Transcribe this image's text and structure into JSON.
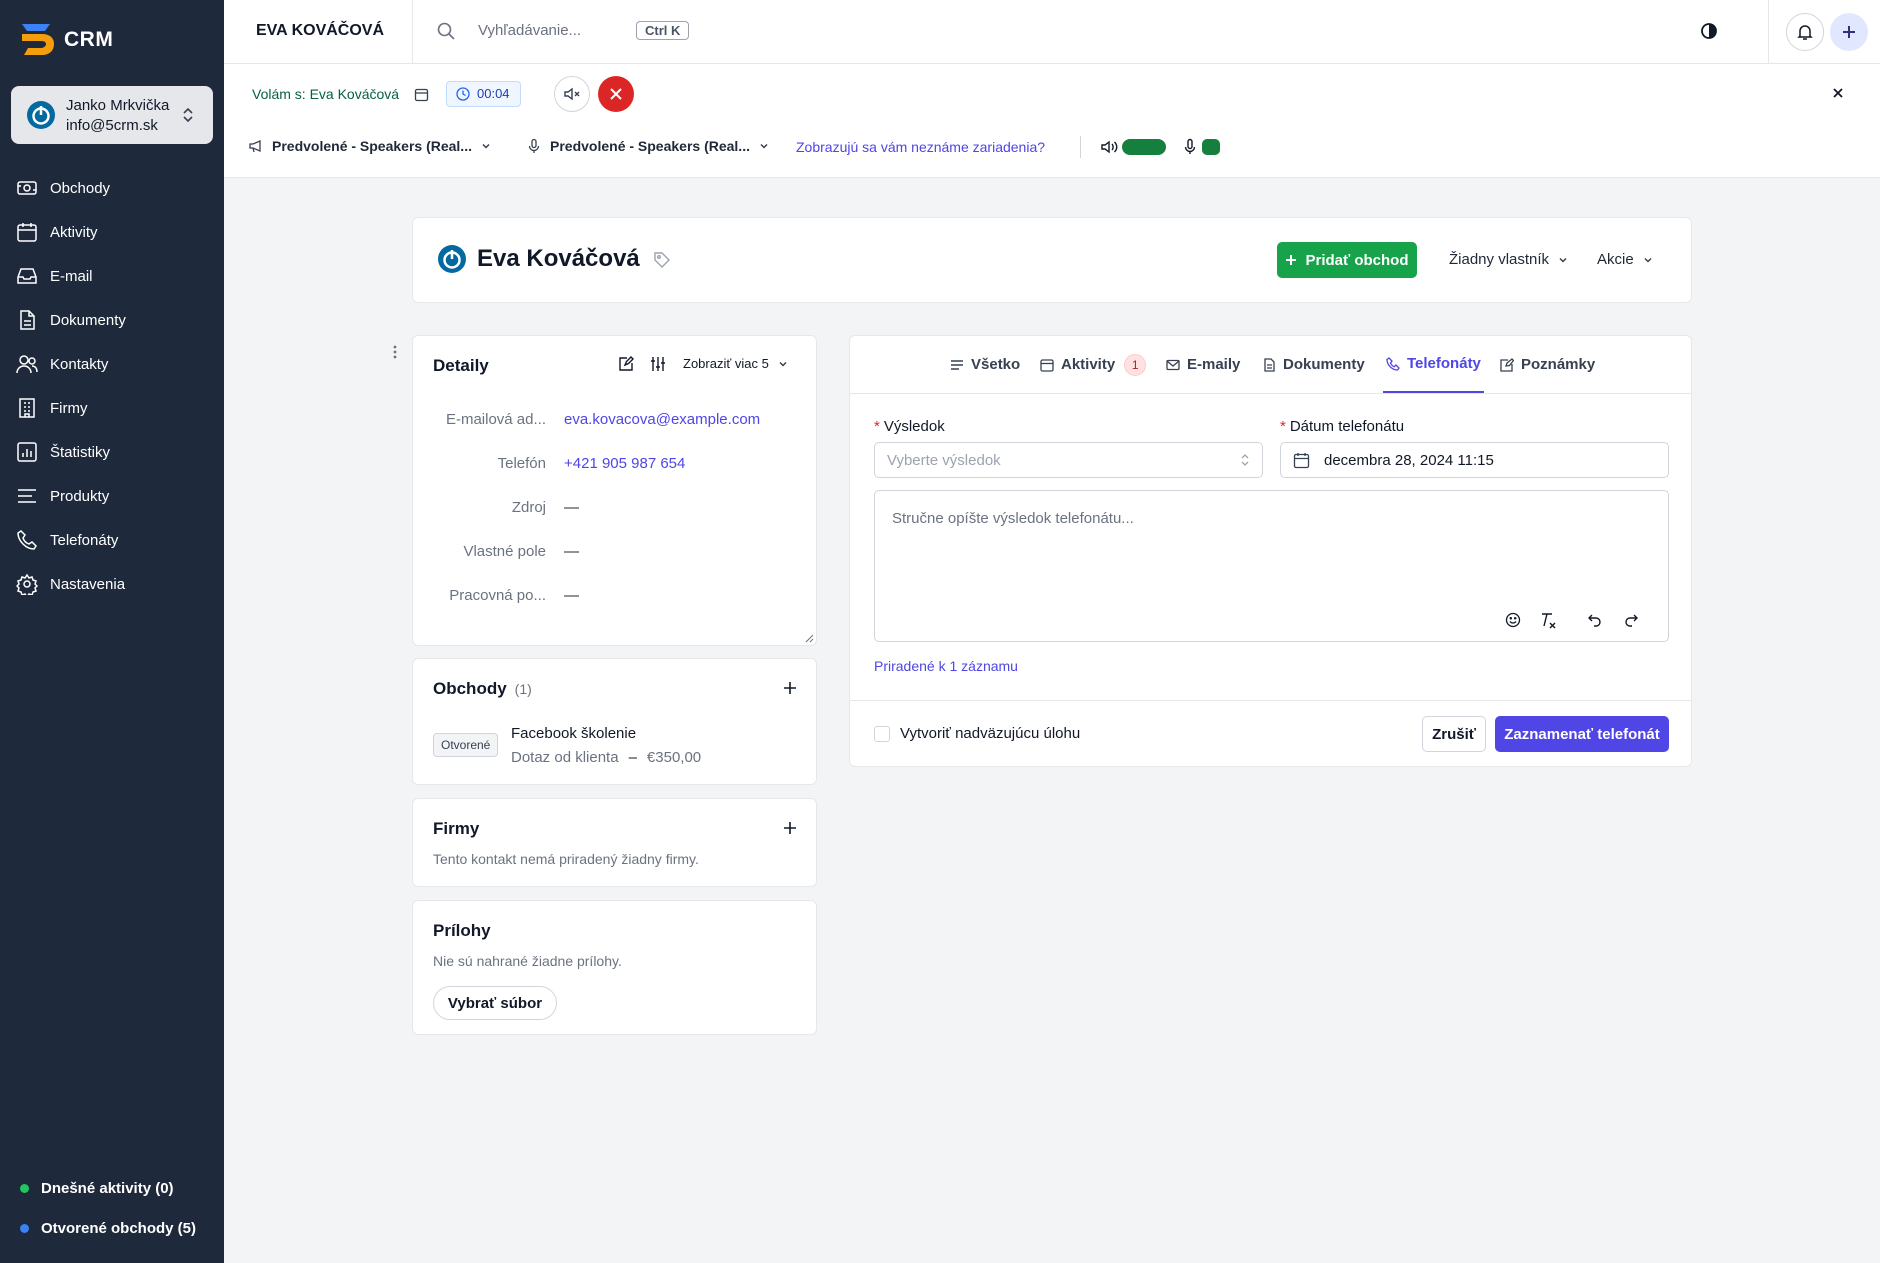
{
  "app": {
    "logo_text": "CRM"
  },
  "user": {
    "name": "Janko Mrkvička",
    "email": "info@5crm.sk"
  },
  "sidebar": {
    "items": [
      {
        "label": "Obchody",
        "icon": "deals-icon"
      },
      {
        "label": "Aktivity",
        "icon": "calendar-icon"
      },
      {
        "label": "E-mail",
        "icon": "inbox-icon"
      },
      {
        "label": "Dokumenty",
        "icon": "document-icon"
      },
      {
        "label": "Kontakty",
        "icon": "contacts-icon"
      },
      {
        "label": "Firmy",
        "icon": "building-icon"
      },
      {
        "label": "Štatistiky",
        "icon": "chart-icon"
      },
      {
        "label": "Produkty",
        "icon": "list-icon"
      },
      {
        "label": "Telefonáty",
        "icon": "phone-icon"
      },
      {
        "label": "Nastavenia",
        "icon": "gear-icon"
      }
    ],
    "stats": [
      {
        "label": "Dnešné aktivity (0)",
        "color": "#22c55e"
      },
      {
        "label": "Otvorené obchody (5)",
        "color": "#3b82f6"
      }
    ]
  },
  "topbar": {
    "title": "EVA KOVÁČOVÁ",
    "search_placeholder": "Vyhľadávanie...",
    "shortcut": "Ctrl K"
  },
  "call": {
    "calling_label": "Volám s: Eva Kováčová",
    "timer": "00:04",
    "speaker_device": "Predvolené - Speakers (Real...",
    "mic_device": "Predvolené - Speakers (Real...",
    "unknown_devices_link": "Zobrazujú sa vám neznáme zariadenia?",
    "colors": {
      "hangup": "#dc2626",
      "level": "#15803d"
    }
  },
  "contact": {
    "name": "Eva Kováčová",
    "add_deal_label": "Pridať obchod",
    "owner_label": "Žiadny vlastník",
    "actions_label": "Akcie"
  },
  "details": {
    "title": "Detaily",
    "show_more": "Zobraziť viac 5",
    "fields": [
      {
        "label": "E-mailová ad...",
        "value": "eva.kovacova@example.com",
        "link": true
      },
      {
        "label": "Telefón",
        "value": "+421 905 987 654",
        "link": true
      },
      {
        "label": "Zdroj",
        "value": "—",
        "link": false
      },
      {
        "label": "Vlastné pole",
        "value": "—",
        "link": false
      },
      {
        "label": "Pracovná po...",
        "value": "—",
        "link": false
      }
    ]
  },
  "deals": {
    "title": "Obchody",
    "count": "(1)",
    "item": {
      "badge": "Otvorené",
      "name": "Facebook školenie",
      "stage": "Dotaz od klienta",
      "separator": "–",
      "amount": "€350,00"
    }
  },
  "companies": {
    "title": "Firmy",
    "empty": "Tento kontakt nemá priradený žiadny firmy."
  },
  "attachments": {
    "title": "Prílohy",
    "empty": "Nie sú nahrané žiadne prílohy.",
    "button": "Vybrať súbor"
  },
  "tabs": [
    {
      "label": "Všetko",
      "icon": "lines-icon"
    },
    {
      "label": "Aktivity",
      "icon": "calendar-icon",
      "badge": "1"
    },
    {
      "label": "E-maily",
      "icon": "mail-icon"
    },
    {
      "label": "Dokumenty",
      "icon": "document-icon"
    },
    {
      "label": "Telefonáty",
      "icon": "phone-icon",
      "active": true
    },
    {
      "label": "Poznámky",
      "icon": "pencil-icon"
    }
  ],
  "call_form": {
    "result_label": "Výsledok",
    "result_placeholder": "Vyberte výsledok",
    "date_label": "Dátum telefonátu",
    "date_value": "decembra 28, 2024 11:15",
    "notes_placeholder": "Stručne opíšte výsledok telefonátu...",
    "assigned_link": "Priradené k 1 záznamu",
    "followup_label": "Vytvoriť nadväzujúcu úlohu",
    "cancel_label": "Zrušiť",
    "submit_label": "Zaznamenať telefonát",
    "accent": "#4f46e5"
  }
}
